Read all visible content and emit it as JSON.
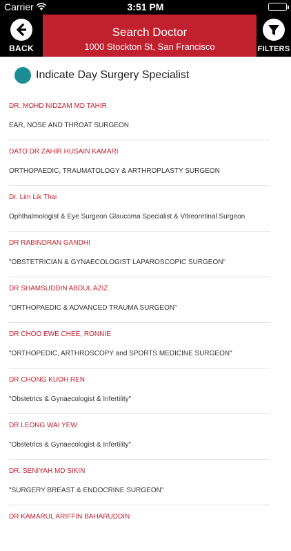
{
  "status_bar": {
    "carrier": "Carrier",
    "time": "3:51 PM"
  },
  "header": {
    "back_label": "BACK",
    "title": "Search Doctor",
    "subtitle": "1000 Stockton St, San Francisco",
    "filters_label": "FILTERS"
  },
  "indicator": {
    "label": "Indicate Day Surgery Specialist",
    "color": "#1a8c94"
  },
  "colors": {
    "brand": "#c1212f",
    "name_text": "#c1212f"
  },
  "doctors": [
    {
      "name": "DR. MOHD NIDZAM MD TAHIR",
      "specialty": "EAR, NOSE AND THROAT SURGEON"
    },
    {
      "name": "DATO DR ZAHIR HUSAIN KAMARI",
      "specialty": "ORTHOPAEDIC, TRAUMATOLOGY & ARTHROPLASTY SURGEON"
    },
    {
      "name": "Dr. Lim Lik Thai",
      "specialty": "Ophthalmologist & Eye Surgeon Glaucoma Specialist & Vitreoretinal Surgeon"
    },
    {
      "name": "DR RABINDRAN GANDHI",
      "specialty": "\"OBSTETRICIAN & GYNAECOLOGIST LAPAROSCOPIC SURGEON\""
    },
    {
      "name": "DR SHAMSUDDIN ABDUL AZIZ",
      "specialty": "\"ORTHOPAEDIC & ADVANCED TRAUMA SURGEON\""
    },
    {
      "name": "DR CHOO EWE CHEE, RONNIE",
      "specialty": "\"ORTHOPEDIC, ARTHROSCOPY and SPORTS MEDICINE SURGEON\""
    },
    {
      "name": "DR CHONG KUOH REN",
      "specialty": "\"Obstetrics & Gynaecologist  & Infertility\""
    },
    {
      "name": "DR LEONG WAI YEW",
      "specialty": "\"Obstetrics & Gynaecologist  & Infertility\""
    },
    {
      "name": "DR. SENIYAH MD SIKIN",
      "specialty": "\"SURGERY BREAST & ENDOCRINE SURGEON\""
    },
    {
      "name": "DR KAMARUL ARIFFIN BAHARUDDIN",
      "specialty": ""
    }
  ]
}
